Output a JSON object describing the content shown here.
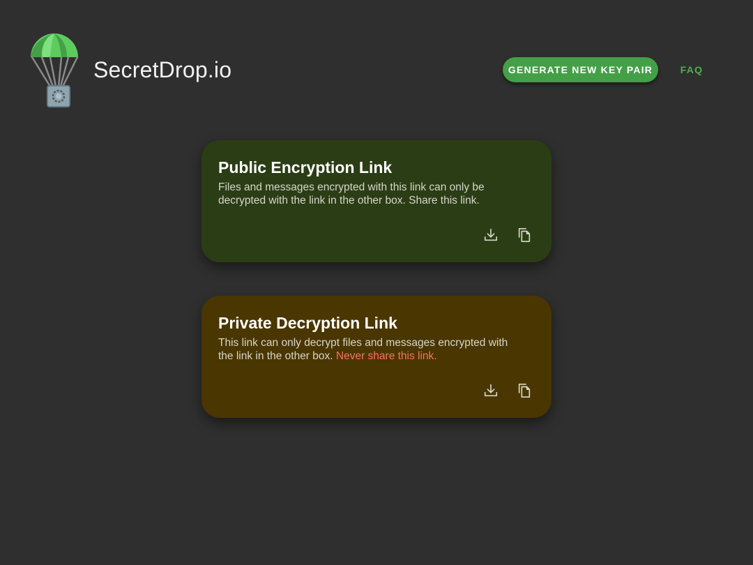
{
  "header": {
    "brand": "SecretDrop.io",
    "generate_label": "GENERATE NEW KEY PAIR",
    "faq_label": "FAQ",
    "logo_icon": "parachute-safe-icon"
  },
  "colors": {
    "background": "#2f2f2f",
    "accent": "#43a047",
    "public_card": "#2b3d15",
    "private_card": "#4a3600",
    "warning": "#ff7066"
  },
  "cards": [
    {
      "title": "Public Encryption Link",
      "description": "Files and messages encrypted with this link can only be decrypted with the link in the other box. Share this link.",
      "actions": [
        "download-icon",
        "copy-icon"
      ]
    },
    {
      "title": "Private Decryption Link",
      "description": "This link can only decrypt files and messages encrypted with the link in the other box.",
      "warning": "Never share this link.",
      "actions": [
        "download-icon",
        "copy-icon"
      ]
    }
  ]
}
